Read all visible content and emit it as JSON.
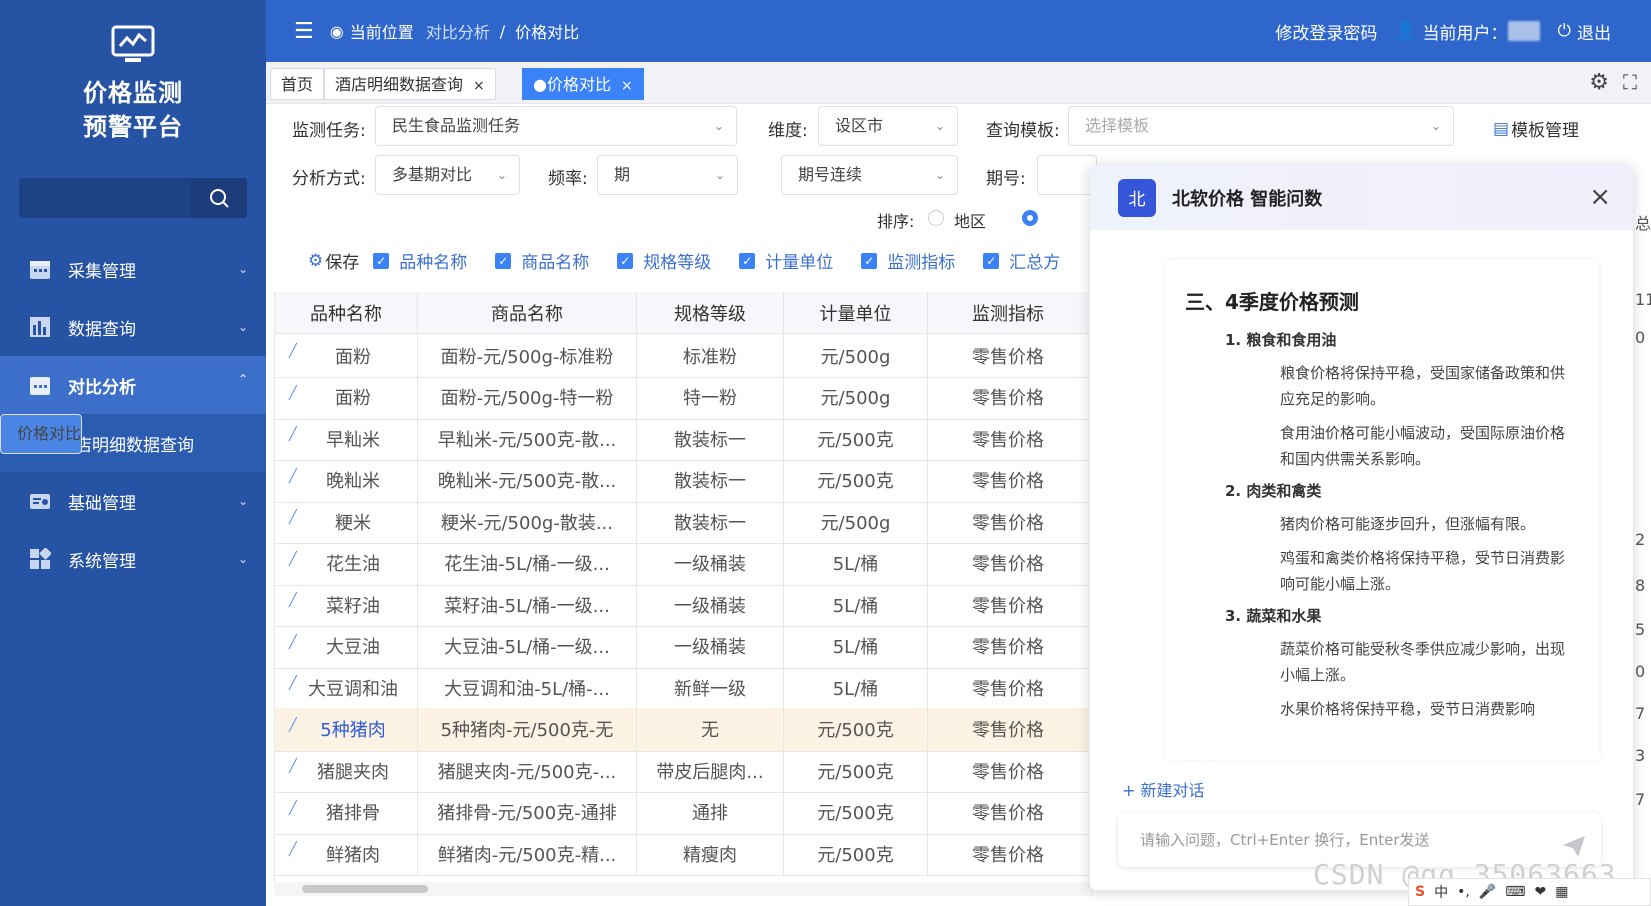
{
  "sidebar": {
    "app_title_line1": "价格监测",
    "app_title_line2": "预警平台",
    "menu": [
      {
        "label": "采集管理",
        "icon": "calendar-icon"
      },
      {
        "label": "数据查询",
        "icon": "bar-chart-icon"
      },
      {
        "label": "对比分析",
        "icon": "calendar-icon"
      },
      {
        "label": "基础管理",
        "icon": "id-card-icon"
      },
      {
        "label": "系统管理",
        "icon": "grid-icon"
      }
    ],
    "submenu": [
      "价格对比",
      "酒店明细数据查询"
    ]
  },
  "topbar": {
    "location_label": "当前位置",
    "breadcrumb": [
      "对比分析",
      "价格对比"
    ],
    "breadcrumb_sep": "/",
    "change_password": "修改登录密码",
    "current_user_label": "当前用户：",
    "logout": "退出"
  },
  "tabs": [
    {
      "label": "首页"
    },
    {
      "label": "酒店明细数据查询",
      "close": "×"
    },
    {
      "label": "●价格对比",
      "close": "×"
    }
  ],
  "filters": {
    "task_label": "监测任务:",
    "task_value": "民生食品监测任务",
    "dimension_label": "维度:",
    "dimension_value": "设区市",
    "template_label": "查询模板:",
    "template_placeholder": "选择模板",
    "template_manage": "模板管理",
    "method_label": "分析方式:",
    "method_value": "多基期对比",
    "freq_label": "频率:",
    "freq_value": "期",
    "period_mode_value": "期号连续",
    "period_label": "期号:",
    "sort_label": "排序:",
    "sort_region": "地区"
  },
  "column_toggles": {
    "save": "保存",
    "items": [
      "品种名称",
      "商品名称",
      "规格等级",
      "计量单位",
      "监测指标",
      "汇总方"
    ]
  },
  "table": {
    "headers": [
      "品种名称",
      "商品名称",
      "规格等级",
      "计量单位",
      "监测指标"
    ],
    "rows": [
      [
        "面粉",
        "面粉-元/500g-标准粉",
        "标准粉",
        "元/500g",
        "零售价格"
      ],
      [
        "面粉",
        "面粉-元/500g-特一粉",
        "特一粉",
        "元/500g",
        "零售价格"
      ],
      [
        "早籼米",
        "早籼米-元/500克-散...",
        "散装标一",
        "元/500克",
        "零售价格"
      ],
      [
        "晚籼米",
        "晚籼米-元/500克-散...",
        "散装标一",
        "元/500克",
        "零售价格"
      ],
      [
        "粳米",
        "粳米-元/500g-散装...",
        "散装标一",
        "元/500g",
        "零售价格"
      ],
      [
        "花生油",
        "花生油-5L/桶-一级...",
        "一级桶装",
        "5L/桶",
        "零售价格"
      ],
      [
        "菜籽油",
        "菜籽油-5L/桶-一级...",
        "一级桶装",
        "5L/桶",
        "零售价格"
      ],
      [
        "大豆油",
        "大豆油-5L/桶-一级...",
        "一级桶装",
        "5L/桶",
        "零售价格"
      ],
      [
        "大豆调和油",
        "大豆调和油-5L/桶-...",
        "新鲜一级",
        "5L/桶",
        "零售价格"
      ],
      [
        "5种猪肉",
        "5种猪肉-元/500克-无",
        "无",
        "元/500克",
        "零售价格"
      ],
      [
        "猪腿夹肉",
        "猪腿夹肉-元/500克-...",
        "带皮后腿肉...",
        "元/500克",
        "零售价格"
      ],
      [
        "猪排骨",
        "猪排骨-元/500克-通排",
        "通排",
        "元/500克",
        "零售价格"
      ],
      [
        "鲜猪肉",
        "鲜猪肉-元/500克-精...",
        "精瘦肉",
        "元/500克",
        "零售价格"
      ]
    ],
    "right_edge": [
      "总",
      "11",
      "0",
      "2",
      "8",
      "5",
      "0",
      "7",
      "3",
      "7"
    ]
  },
  "chat": {
    "logo": "北",
    "title": "北软价格 智能问数",
    "close": "×",
    "heading": "三、4季度价格预测",
    "sections": [
      {
        "title": "1. 粮食和食用油",
        "paras": [
          "粮食价格将保持平稳，受国家储备政策和供应充足的影响。",
          "食用油价格可能小幅波动，受国际原油价格和国内供需关系影响。"
        ]
      },
      {
        "title": "2. 肉类和禽类",
        "paras": [
          "猪肉价格可能逐步回升，但涨幅有限。",
          "鸡蛋和禽类价格将保持平稳，受节日消费影响可能小幅上涨。"
        ]
      },
      {
        "title": "3. 蔬菜和水果",
        "paras": [
          "蔬菜价格可能受秋冬季供应减少影响，出现小幅上涨。",
          "水果价格将保持平稳，受节日消费影响"
        ]
      }
    ],
    "new_chat": "+ 新建对话",
    "input_placeholder": "请输入问题，Ctrl+Enter 换行，Enter发送"
  },
  "overlay": {
    "watermark": "CSDN @qq_35063663",
    "ime_label": "中"
  }
}
